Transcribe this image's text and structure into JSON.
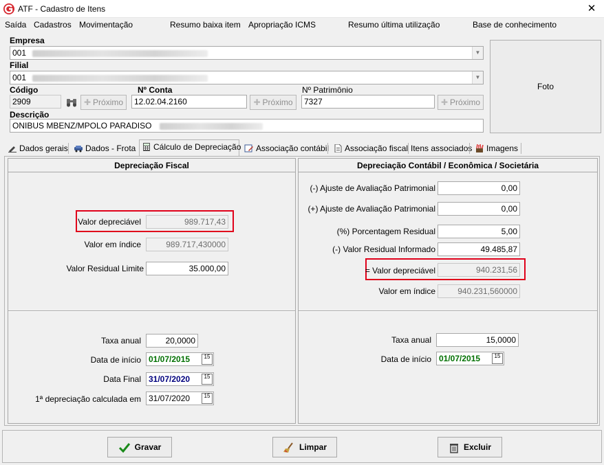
{
  "window": {
    "title": "ATF - Cadastro de Itens",
    "close": "✕"
  },
  "menu": [
    "Saída",
    "Cadastros",
    "Movimentação",
    "Resumo baixa item",
    "Apropriação ICMS",
    "Resumo última utilização",
    "Base de conhecimento"
  ],
  "form": {
    "empresa_label": "Empresa",
    "empresa_value": "001",
    "filial_label": "Filial",
    "filial_value": "001",
    "codigo_label": "Código",
    "codigo_value": "2909",
    "conta_label": "Nº Conta",
    "conta_value": "12.02.04.2160",
    "patrimonio_label": "Nº Patrimônio",
    "patrimonio_value": "7327",
    "proximo_label": "Próximo",
    "descricao_label": "Descrição",
    "descricao_value": "ONIBUS MBENZ/MPOLO PARADISO",
    "foto_label": "Foto"
  },
  "tabs": [
    "Dados gerais",
    "Dados - Frota",
    "Cálculo de Depreciação",
    "Associação contábil",
    "Associação fiscal",
    "Itens associados",
    "Imagens"
  ],
  "fiscal": {
    "header": "Depreciação Fiscal",
    "valor_depreciavel_label": "Valor depreciável",
    "valor_depreciavel": "989.717,43",
    "valor_indice_label": "Valor em índice",
    "valor_indice": "989.717,430000",
    "valor_residual_label": "Valor Residual Limite",
    "valor_residual": "35.000,00",
    "taxa_label": "Taxa anual",
    "taxa": "20,0000",
    "data_inicio_label": "Data de início",
    "data_inicio": "01/07/2015",
    "data_final_label": "Data Final",
    "data_final": "31/07/2020",
    "primeira_label": "1ª depreciação calculada em",
    "primeira": "31/07/2020"
  },
  "contabil": {
    "header": "Depreciação Contábil / Econômica / Societária",
    "ajuste_neg_label": "(-) Ajuste de Avaliação Patrimonial",
    "ajuste_neg": "0,00",
    "ajuste_pos_label": "(+) Ajuste de Avaliação Patrimonial",
    "ajuste_pos": "0,00",
    "porcentagem_label": "(%) Porcentagem Residual",
    "porcentagem": "5,00",
    "residual_label": "(-) Valor Residual Informado",
    "residual": "49.485,87",
    "valor_depreciavel_label": "= Valor depreciável",
    "valor_depreciavel": "940.231,56",
    "valor_indice_label": "Valor em índice",
    "valor_indice": "940.231,560000",
    "taxa_label": "Taxa anual",
    "taxa": "15,0000",
    "data_inicio_label": "Data de início",
    "data_inicio": "01/07/2015"
  },
  "buttons": {
    "gravar": "Gravar",
    "limpar": "Limpar",
    "excluir": "Excluir"
  },
  "calendar_glyph": "15"
}
